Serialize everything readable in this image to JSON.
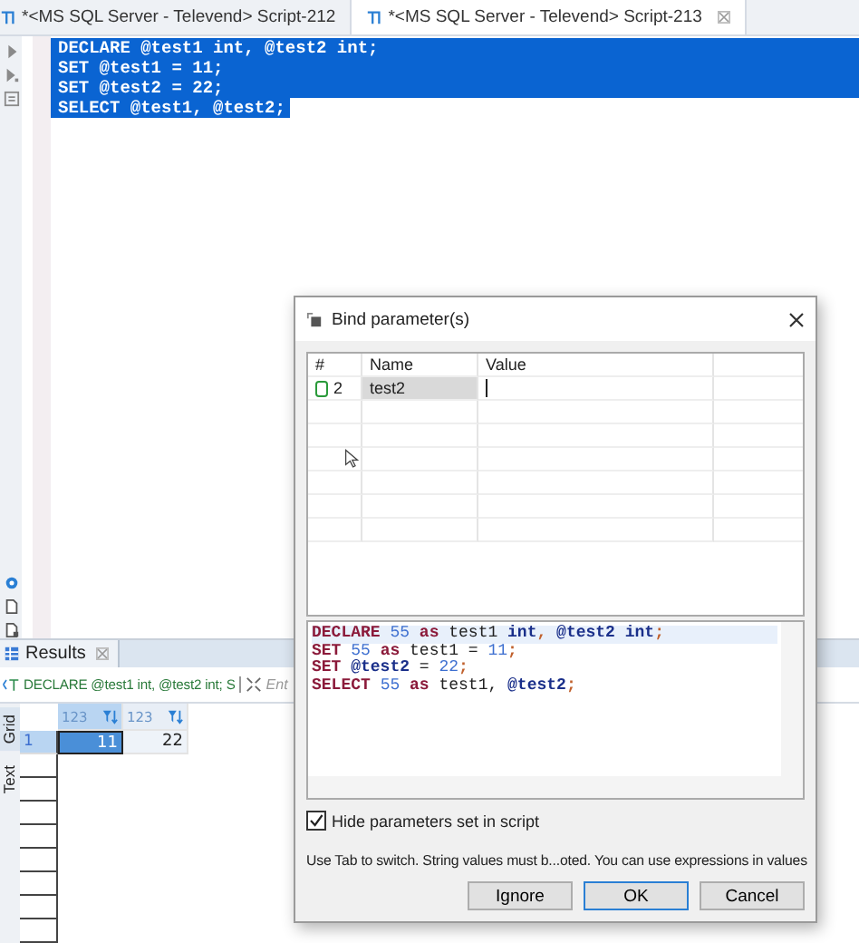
{
  "tabs": [
    {
      "label": "*<MS SQL Server - Televend> Script-212",
      "selected": false
    },
    {
      "label": "*<MS SQL Server - Televend> Script-213",
      "selected": true
    }
  ],
  "editor": {
    "lines": [
      {
        "text": "DECLARE @test1 int, @test2 int;",
        "selected": true
      },
      {
        "text": "SET @test1 = 11;",
        "selected": true
      },
      {
        "text": "SET @test2 = 22;",
        "selected": true
      },
      {
        "text": "SELECT @test1, @test2;",
        "selected": true
      }
    ]
  },
  "results": {
    "tab": "Results",
    "query": "DECLARE @test1 int, @test2 int; S",
    "filter_placeholder": "Ent",
    "side_tabs": [
      {
        "label": "Grid",
        "selected": true
      },
      {
        "label": "Text",
        "selected": false
      }
    ],
    "columns": [
      "123",
      "123"
    ],
    "rows": [
      {
        "number": "1",
        "cells": [
          "11",
          "22"
        ],
        "selected": true
      }
    ]
  },
  "dialog": {
    "title": "Bind parameter(s)",
    "columns": [
      "#",
      "Name",
      "Value"
    ],
    "params": [
      {
        "index": "2",
        "name": "test2",
        "selected": true
      }
    ],
    "preview": [
      [
        {
          "kind": "kw",
          "text": "DECLARE "
        },
        {
          "kind": "num",
          "text": "55 "
        },
        {
          "kind": "kw",
          "text": "as "
        },
        {
          "kind": "id",
          "text": "test1 "
        },
        {
          "kind": "type",
          "text": "int"
        },
        {
          "kind": "punct",
          "text": ", "
        },
        {
          "kind": "var",
          "text": "@test2 "
        },
        {
          "kind": "type",
          "text": "int"
        },
        {
          "kind": "punct",
          "text": ";"
        }
      ],
      [
        {
          "kind": "kw",
          "text": "SET "
        },
        {
          "kind": "num",
          "text": "55 "
        },
        {
          "kind": "kw",
          "text": "as "
        },
        {
          "kind": "id",
          "text": "test1 = "
        },
        {
          "kind": "num",
          "text": "11"
        },
        {
          "kind": "punct",
          "text": ";"
        }
      ],
      [
        {
          "kind": "kw",
          "text": "SET "
        },
        {
          "kind": "var",
          "text": "@test2"
        },
        {
          "kind": "id",
          "text": " = "
        },
        {
          "kind": "num",
          "text": "22"
        },
        {
          "kind": "punct",
          "text": ";"
        }
      ],
      [
        {
          "kind": "kw",
          "text": "SELECT "
        },
        {
          "kind": "num",
          "text": "55 "
        },
        {
          "kind": "kw",
          "text": "as "
        },
        {
          "kind": "id",
          "text": "test1, "
        },
        {
          "kind": "var",
          "text": "@test2"
        },
        {
          "kind": "punct",
          "text": ";"
        }
      ]
    ],
    "checkbox": {
      "label": "Hide parameters set in script",
      "checked": true
    },
    "hint": "Use Tab to switch. String values must b...oted. You can use expressions in values",
    "buttons": [
      {
        "label": "Ignore",
        "default": false
      },
      {
        "label": "OK",
        "default": true
      },
      {
        "label": "Cancel",
        "default": false
      }
    ]
  }
}
